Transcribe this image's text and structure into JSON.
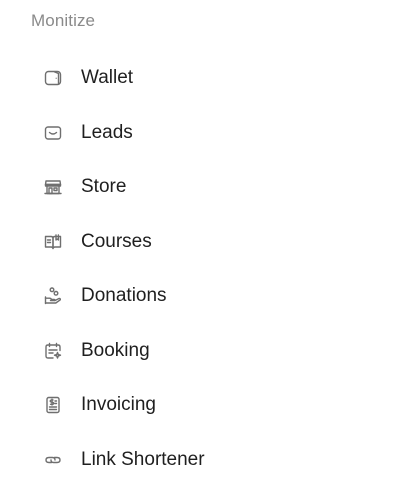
{
  "section": {
    "heading": "Monitize",
    "items": [
      {
        "label": "Wallet",
        "icon": "wallet-icon"
      },
      {
        "label": "Leads",
        "icon": "inbox-icon"
      },
      {
        "label": "Store",
        "icon": "storefront-icon"
      },
      {
        "label": "Courses",
        "icon": "book-icon"
      },
      {
        "label": "Donations",
        "icon": "hand-coins-icon"
      },
      {
        "label": "Booking",
        "icon": "calendar-icon"
      },
      {
        "label": "Invoicing",
        "icon": "invoice-icon"
      },
      {
        "label": "Link Shortener",
        "icon": "link-icon"
      }
    ]
  },
  "colors": {
    "heading": "#8a8a8a",
    "label": "#1f1f1f",
    "icon": "#6f6f6f",
    "background": "#ffffff"
  }
}
